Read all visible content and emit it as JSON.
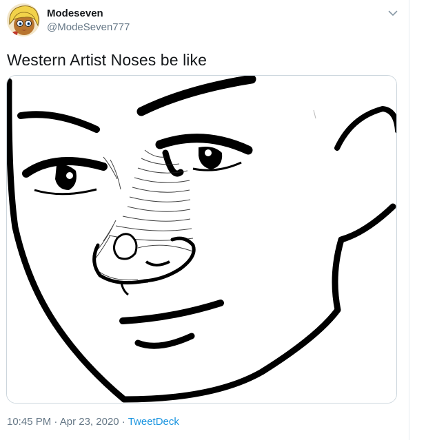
{
  "user": {
    "display_name": "Modeseven",
    "handle": "@ModeSeven777",
    "avatar_icon": "anime-character-avatar"
  },
  "menu": {
    "icon": "chevron-down-icon"
  },
  "tweet": {
    "text": "Western Artist Noses be like"
  },
  "media": {
    "description_icon": "face-drawing-image"
  },
  "meta": {
    "time": "10:45 PM",
    "sep1": " · ",
    "date": "Apr 23, 2020",
    "sep2": " · ",
    "source": "TweetDeck"
  },
  "colors": {
    "text": "#14171a",
    "secondary": "#657786",
    "link": "#1b95e0",
    "border": "#ccd6dd"
  }
}
